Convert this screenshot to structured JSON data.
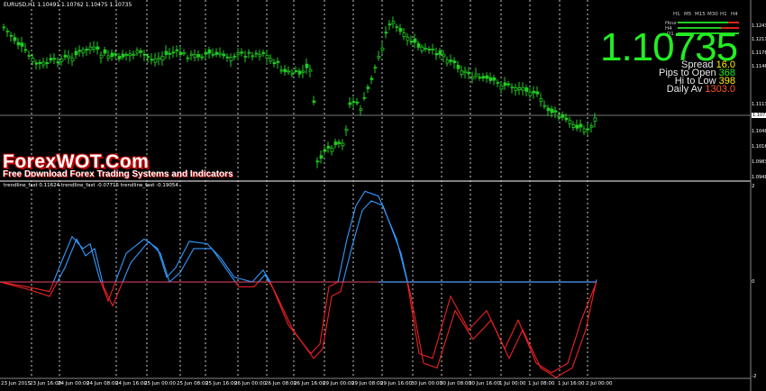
{
  "chart": {
    "symbol_header": "EURUSD,H1  1.10491 1.10762 1.10475 1.10735",
    "current_price": "1.10735",
    "price_axis": [
      "1.12435",
      "1.12110",
      "1.11785",
      "1.11460",
      "1.11135",
      "1.10735",
      "1.10485",
      "1.10160",
      "1.09835",
      "1.09480"
    ],
    "timeframes": [
      "H1",
      "M5",
      "M15",
      "M30",
      "H1",
      "H4"
    ],
    "strength_labels": [
      "Hour",
      "H4",
      "D1"
    ],
    "colors": {
      "bull": "#22cc22",
      "bear": "#22cc22",
      "upper_line": "#3399ff",
      "lower_line": "#ff2222"
    }
  },
  "info_panel": {
    "spread_label": "Spread",
    "spread_value": "16.0",
    "pips_label": "Pips to Open",
    "pips_value": "368",
    "hilow_label": "Hi to Low",
    "hilow_value": "398",
    "daily_label": "Daily Av",
    "daily_value": "1303.0"
  },
  "watermark": {
    "title": "ForexWOT.Com",
    "subtitle": "Free Download Forex Trading Systems and Indicators"
  },
  "indicator": {
    "header": "trendline_fast 0.11624  trendline_fast -0.07715  trendline_fast -0.19054",
    "axis": [
      "2",
      "0",
      "-2"
    ]
  },
  "time_axis": [
    "23 Jun 2015",
    "23 Jun 16:00",
    "24 Jun 00:00",
    "24 Jun 08:00",
    "24 Jun 16:00",
    "25 Jun 00:00",
    "25 Jun 08:00",
    "25 Jun 16:00",
    "26 Jun 00:00",
    "26 Jun 08:00",
    "26 Jun 16:00",
    "29 Jun 00:00",
    "29 Jun 08:00",
    "29 Jun 16:00",
    "30 Jun 00:00",
    "30 Jun 08:00",
    "30 Jun 16:00",
    "1 Jul 00:00",
    "1 Jul 08:00",
    "1 Jul 16:00",
    "2 Jul 00:00"
  ]
}
